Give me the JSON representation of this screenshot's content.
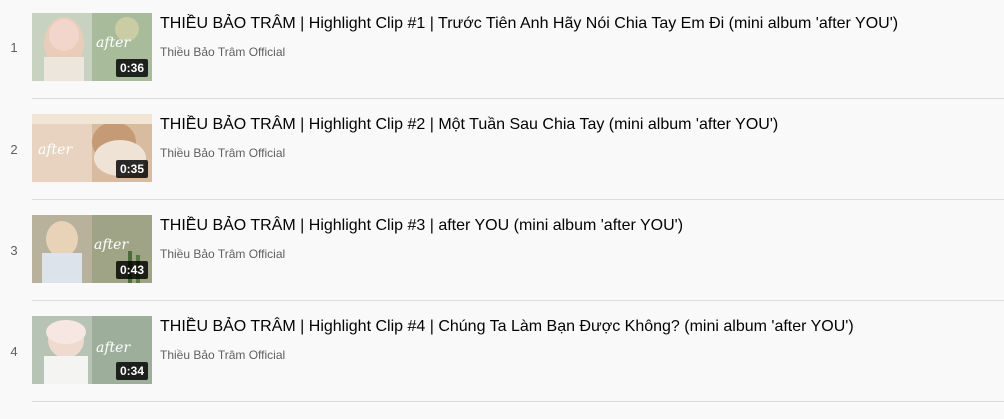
{
  "playlist": {
    "items": [
      {
        "index": "1",
        "title": "THIỀU BẢO TRÂM | Highlight Clip #1 | Trước Tiên Anh Hãy Nói Chia Tay Em Đi (mini album 'after YOU')",
        "channel": "Thiều Bảo Trâm Official",
        "duration": "0:36",
        "thumb_text": "after"
      },
      {
        "index": "2",
        "title": "THIỀU BẢO TRÂM | Highlight Clip #2 | Một Tuần Sau Chia Tay (mini album 'after YOU')",
        "channel": "Thiều Bảo Trâm Official",
        "duration": "0:35",
        "thumb_text": "after"
      },
      {
        "index": "3",
        "title": "THIỀU BẢO TRÂM | Highlight Clip #3 | after YOU (mini album 'after YOU')",
        "channel": "Thiều Bảo Trâm Official",
        "duration": "0:43",
        "thumb_text": "after"
      },
      {
        "index": "4",
        "title": "THIỀU BẢO TRÂM | Highlight Clip #4 | Chúng Ta Làm Bạn Được Không? (mini album 'after YOU')",
        "channel": "Thiều Bảo Trâm Official",
        "duration": "0:34",
        "thumb_text": "after"
      }
    ]
  }
}
